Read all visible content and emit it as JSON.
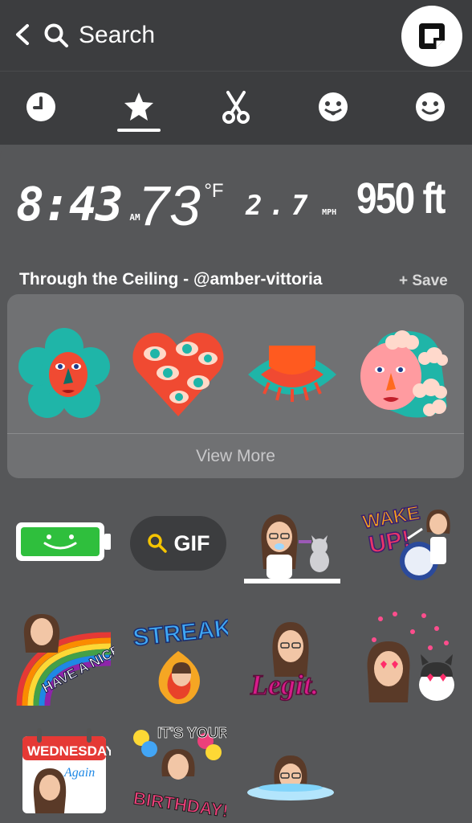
{
  "header": {
    "search_label": "Search"
  },
  "categories": [
    {
      "icon": "clock-icon",
      "label": "recent"
    },
    {
      "icon": "star-icon",
      "label": "favorites"
    },
    {
      "icon": "scissors-icon",
      "label": "cutouts"
    },
    {
      "icon": "face-tongue-icon",
      "label": "bitmoji"
    },
    {
      "icon": "smiley-icon",
      "label": "emoji"
    }
  ],
  "geo_stickers": {
    "time": "8:43",
    "time_suffix": "AM",
    "temperature": "73",
    "temperature_unit": "°F",
    "speed": "2.7",
    "speed_unit": "MPH",
    "altitude": "950 ft"
  },
  "pack": {
    "title": "Through the Ceiling - @amber-vittoria",
    "save_label": "+ Save",
    "view_more_label": "View More"
  },
  "gif_button": {
    "label": "GIF"
  },
  "bitmoji_text": {
    "wake_up": "WAKE UP!",
    "nice_day": "HAVE A NICE DAY",
    "streak": "STREAK",
    "legit": "Legit.",
    "wednesday": "WEDNESDAY",
    "again": "Again",
    "its_your": "IT'S YOUR",
    "birthday": "BIRTHDAY!"
  },
  "colors": {
    "top_bar": "#3c3d3f",
    "panel": "#565759",
    "pack_card": "#707173",
    "teal": "#1fb5a8",
    "coral": "#f04a32",
    "battery_green": "#2fbf3d",
    "gif_search_yellow": "#f5c400"
  }
}
